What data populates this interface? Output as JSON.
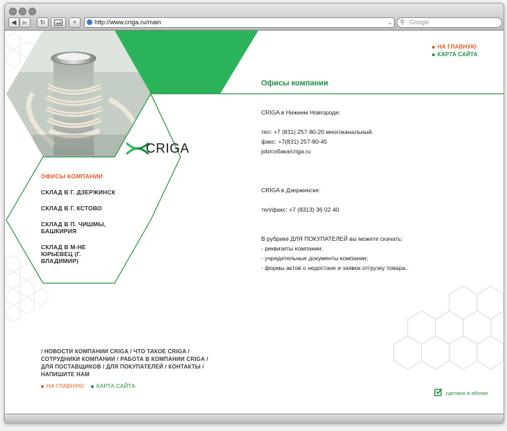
{
  "browser": {
    "url": "http://www.criga.ru/main",
    "search_placeholder": "Google",
    "back_icon": "◀",
    "forward_icon": "▶",
    "reload_icon": "↻",
    "add_icon": "+"
  },
  "logo": {
    "text": "CRIGA"
  },
  "top_links": [
    {
      "label": "НА ГЛАВНУЮ",
      "color": "#e05a20"
    },
    {
      "label": "КАРТА САЙТА",
      "color": "#1e8f3e"
    }
  ],
  "page_title": "Офисы компании",
  "sidebar": {
    "items": [
      {
        "lines": [
          "ОФИСЫ КОМПАНИИ"
        ],
        "active": true
      },
      {
        "lines": [
          "СКЛАД В Г. ДЗЕРЖИНСК"
        ],
        "active": false
      },
      {
        "lines": [
          "СКЛАД В Г. КСТОВО"
        ],
        "active": false
      },
      {
        "lines": [
          "СКЛАД В П. ЧИШМЫ,",
          "БАШКИРИЯ"
        ],
        "active": false
      },
      {
        "lines": [
          "СКЛАД В М-НЕ",
          "ЮРЬЕВЕЦ (Г.",
          "ВЛАДИМИР)"
        ],
        "active": false
      }
    ]
  },
  "content": {
    "office1_title": "CRIGA в Нижнем Новгороде:",
    "office1_phone": "тел:   +7 (831) 257-80-20 многоканальный.",
    "office1_fax": "факс:  +7(831) 257-80-45",
    "office1_email": "job/собака/criga.ru",
    "office2_title": "CRIGA в Дзержинске:",
    "office2_phone": "тел/факс:  +7 (8313) 36 02 40",
    "downloads_intro": "В рубрике ДЛЯ ПОКУПАТЕЛЕЙ вы можете скачать:",
    "downloads": [
      "- реквизиты компании;",
      "- учредительные документы компании;",
      "- формы актов о недостаче и  заявок отгрузку товара.."
    ]
  },
  "footer": {
    "row1": [
      "НОВОСТИ КОМПАНИИ CRIGA",
      "ЧТО ТАКОЕ CRIGA"
    ],
    "row2": [
      "СОТРУДНИКИ КОМПАНИИ",
      "РАБОТА В КОМПАНИИ CRIGA"
    ],
    "row3": [
      "ДЛЯ ПОСТАВЩИКОВ",
      "ДЛЯ ПОКУПАТЕЛЕЙ",
      "КОНТАКТЫ"
    ],
    "row4": [
      "НАПИШИТЕ НАМ"
    ],
    "home_link": "НА ГЛАВНУЮ",
    "sitemap_link": "КАРТА САЙТА",
    "credit": "сделано в яблоке"
  },
  "colors": {
    "green": "#2bb35a",
    "dark_green": "#1e8f3e",
    "orange": "#e05a20"
  }
}
